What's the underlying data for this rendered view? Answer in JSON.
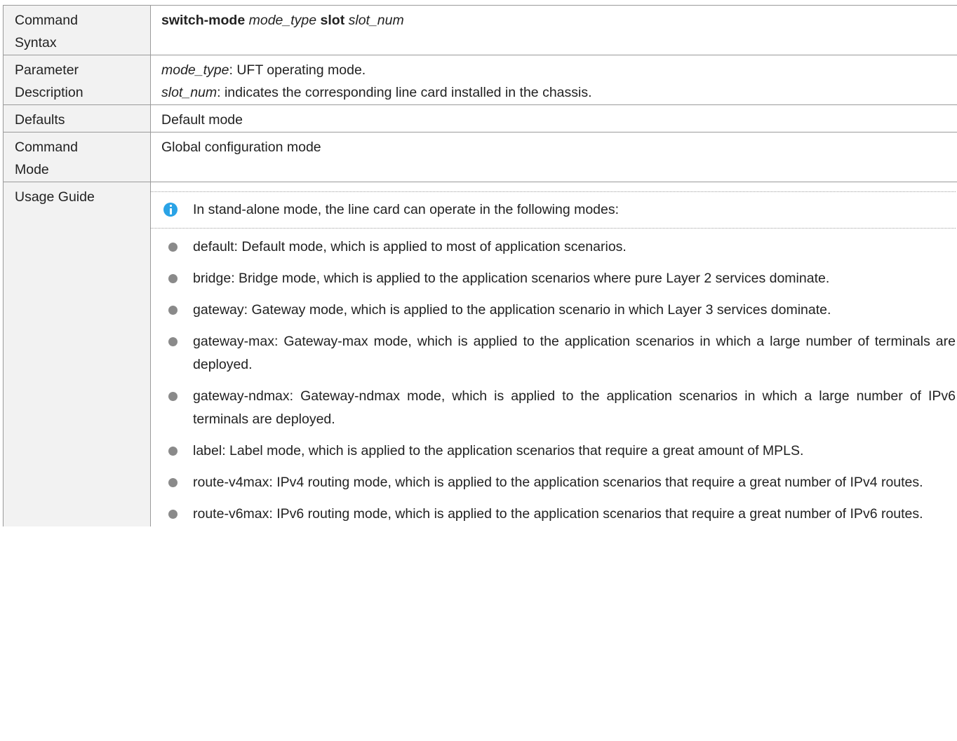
{
  "rows": {
    "syntax": {
      "label_line1": "Command",
      "label_line2": "Syntax",
      "cmd": "switch-mode",
      "arg1": "mode_type",
      "kw": "slot",
      "arg2": "slot_num"
    },
    "params": {
      "label_line1": "Parameter",
      "label_line2": "Description",
      "p1_name": "mode_type",
      "p1_desc": ": UFT operating mode.",
      "p2_name": "slot_num",
      "p2_desc": ": indicates the corresponding line card installed in the chassis."
    },
    "defaults": {
      "label": "Defaults",
      "value": "Default mode"
    },
    "mode": {
      "label_line1": "Command",
      "label_line2": "Mode",
      "value": "Global configuration mode"
    },
    "usage": {
      "label": "Usage Guide",
      "note_icon": "info-icon",
      "note": "In stand-alone mode, the line card can operate in the following modes:",
      "items": [
        "default: Default mode, which is applied to most of application scenarios.",
        "bridge: Bridge mode, which is applied to the application scenarios where pure Layer 2 services dominate.",
        "gateway: Gateway mode, which is applied to the application scenario in which Layer 3 services dominate.",
        "gateway-max: Gateway-max mode, which is applied to the application scenarios in which a large number of terminals are deployed.",
        "gateway-ndmax: Gateway-ndmax mode, which is applied to the application scenarios in which a large number of IPv6 terminals are deployed.",
        "label: Label mode, which is applied to the application scenarios that require a great amount of MPLS.",
        "route-v4max: IPv4 routing mode, which is applied to the application scenarios that require a great number of IPv4 routes.",
        "route-v6max: IPv6 routing mode, which is applied to the application scenarios that require a great number of IPv6 routes."
      ]
    }
  },
  "colors": {
    "label_bg": "#f2f2f2",
    "border": "#9a9a9a",
    "info_icon": "#2aa3e6",
    "bullet": "#8a8a8a"
  }
}
